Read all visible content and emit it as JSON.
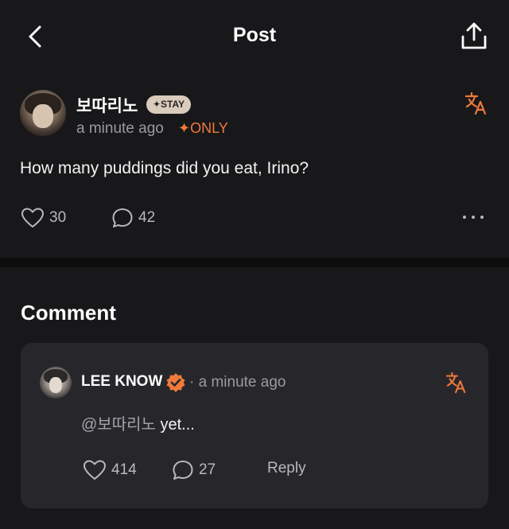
{
  "header": {
    "title": "Post"
  },
  "post": {
    "username": "보따리노",
    "badge": "✦STAY",
    "time": "a minute ago",
    "only_label": "✦ONLY",
    "text": "How many puddings did you eat, Irino?",
    "likes": "30",
    "comments": "42"
  },
  "comments_section": {
    "heading": "Comment",
    "items": [
      {
        "author": "LEE KNOW",
        "time": "· a minute ago",
        "mention": "@보따리노",
        "text": " yet...",
        "likes": "414",
        "replies": "27",
        "reply_label": "Reply"
      }
    ]
  },
  "icons": {
    "back": "chevron-left-icon",
    "share": "share-icon",
    "translate": "translate-icon",
    "like": "heart-icon",
    "comment": "comment-bubble-icon",
    "more": "more-dots-icon",
    "verified": "verified-badge-icon"
  },
  "colors": {
    "background": "#18181a",
    "card": "#27272b",
    "accent": "#ef7a3a",
    "badge": "#d9ccbd",
    "muted_text": "#9a9aa0"
  }
}
